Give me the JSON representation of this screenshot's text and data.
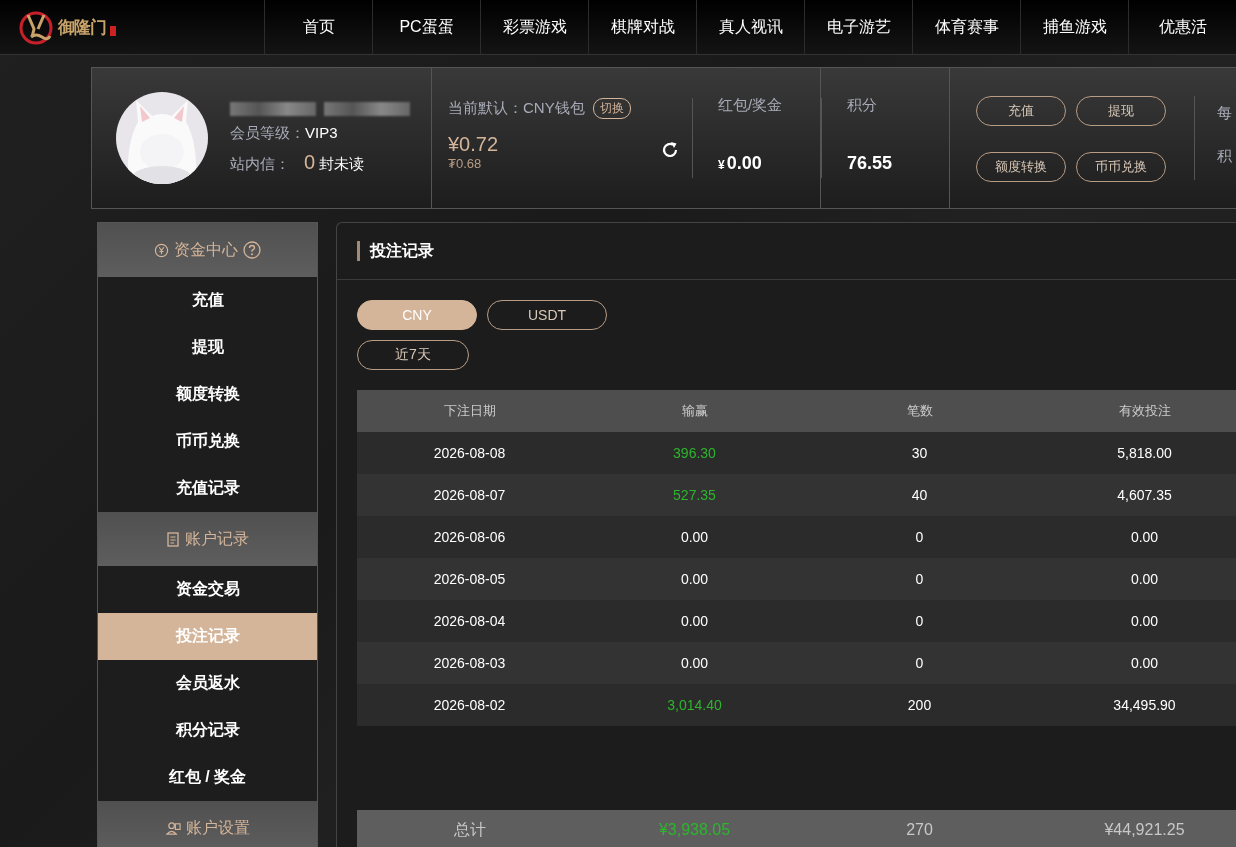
{
  "logo": {
    "text": "御隆门"
  },
  "nav": [
    {
      "label": "首页"
    },
    {
      "label": "PC蛋蛋"
    },
    {
      "label": "彩票游戏"
    },
    {
      "label": "棋牌对战"
    },
    {
      "label": "真人视讯"
    },
    {
      "label": "电子游艺"
    },
    {
      "label": "体育赛事"
    },
    {
      "label": "捕鱼游戏"
    },
    {
      "label": "优惠活"
    }
  ],
  "profile": {
    "vip_label": "会员等级：",
    "vip": "VIP3",
    "mail_label": "站内信：",
    "mail_count": "0",
    "mail_suffix": "封未读"
  },
  "wallet": {
    "label": "当前默认：CNY钱包",
    "switch": "切换",
    "balance": "¥0.72",
    "sub_balance": "₮0.68"
  },
  "stats": [
    {
      "label": "红包/奖金",
      "prefix": "¥",
      "value": "0.00"
    },
    {
      "label": "积分",
      "value": "76.55"
    }
  ],
  "actions": [
    "充值",
    "提现",
    "额度转换",
    "币币兑换"
  ],
  "daily": [
    "每",
    "积"
  ],
  "sidebar": [
    {
      "kind": "header",
      "label": "资金中心",
      "help": true
    },
    {
      "kind": "item",
      "label": "充值",
      "selected": false
    },
    {
      "kind": "item",
      "label": "提现",
      "selected": false
    },
    {
      "kind": "item",
      "label": "额度转换",
      "selected": false
    },
    {
      "kind": "item",
      "label": "币币兑换",
      "selected": false
    },
    {
      "kind": "item",
      "label": "充值记录",
      "selected": false
    },
    {
      "kind": "header",
      "label": "账户记录",
      "help": false
    },
    {
      "kind": "item",
      "label": "资金交易",
      "selected": false
    },
    {
      "kind": "item",
      "label": "投注记录",
      "selected": true
    },
    {
      "kind": "item",
      "label": "会员返水",
      "selected": false
    },
    {
      "kind": "item",
      "label": "积分记录",
      "selected": false
    },
    {
      "kind": "item",
      "label": "红包 / 奖金",
      "selected": false
    },
    {
      "kind": "header",
      "label": "账户设置",
      "help": false
    }
  ],
  "panel": {
    "title": "投注记录",
    "currencies": [
      {
        "label": "CNY",
        "selected": true
      },
      {
        "label": "USDT",
        "selected": false
      }
    ],
    "range": "近7天",
    "table": {
      "columns": [
        "下注日期",
        "输赢",
        "笔数",
        "有效投注"
      ],
      "rows": [
        {
          "date": "2026-08-08",
          "win": "396.30",
          "positive": true,
          "count": "30",
          "valid": "5,818.00"
        },
        {
          "date": "2026-08-07",
          "win": "527.35",
          "positive": true,
          "count": "40",
          "valid": "4,607.35"
        },
        {
          "date": "2026-08-06",
          "win": "0.00",
          "positive": false,
          "count": "0",
          "valid": "0.00"
        },
        {
          "date": "2026-08-05",
          "win": "0.00",
          "positive": false,
          "count": "0",
          "valid": "0.00"
        },
        {
          "date": "2026-08-04",
          "win": "0.00",
          "positive": false,
          "count": "0",
          "valid": "0.00"
        },
        {
          "date": "2026-08-03",
          "win": "0.00",
          "positive": false,
          "count": "0",
          "valid": "0.00"
        },
        {
          "date": "2026-08-02",
          "win": "3,014.40",
          "positive": true,
          "count": "200",
          "valid": "34,495.90"
        }
      ],
      "total": {
        "label": "总计",
        "win": "¥3,938.05",
        "positive": true,
        "count": "270",
        "valid": "¥44,921.25"
      }
    }
  }
}
